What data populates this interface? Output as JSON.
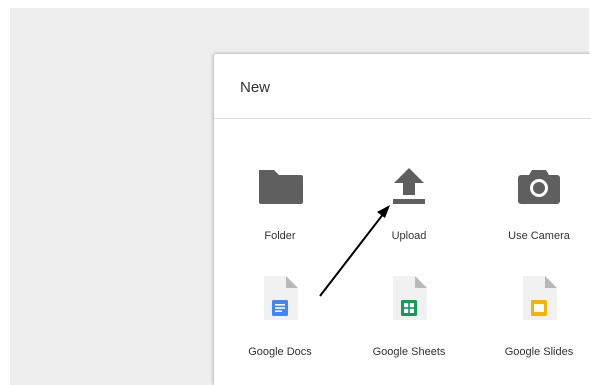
{
  "dialog": {
    "title": "New",
    "items": [
      {
        "label": "Folder",
        "icon": "folder-icon"
      },
      {
        "label": "Upload",
        "icon": "upload-icon"
      },
      {
        "label": "Use Camera",
        "icon": "camera-icon"
      },
      {
        "label": "Google Docs",
        "icon": "google-docs-icon"
      },
      {
        "label": "Google Sheets",
        "icon": "google-sheets-icon"
      },
      {
        "label": "Google Slides",
        "icon": "google-slides-icon"
      }
    ]
  },
  "colors": {
    "icon_gray": "#5f5f5f",
    "docs_blue": "#4285f4",
    "sheets_green": "#0f9d58",
    "slides_yellow": "#f4b400",
    "file_page": "#f1f1f1",
    "annotation_arrow": "#000000"
  }
}
